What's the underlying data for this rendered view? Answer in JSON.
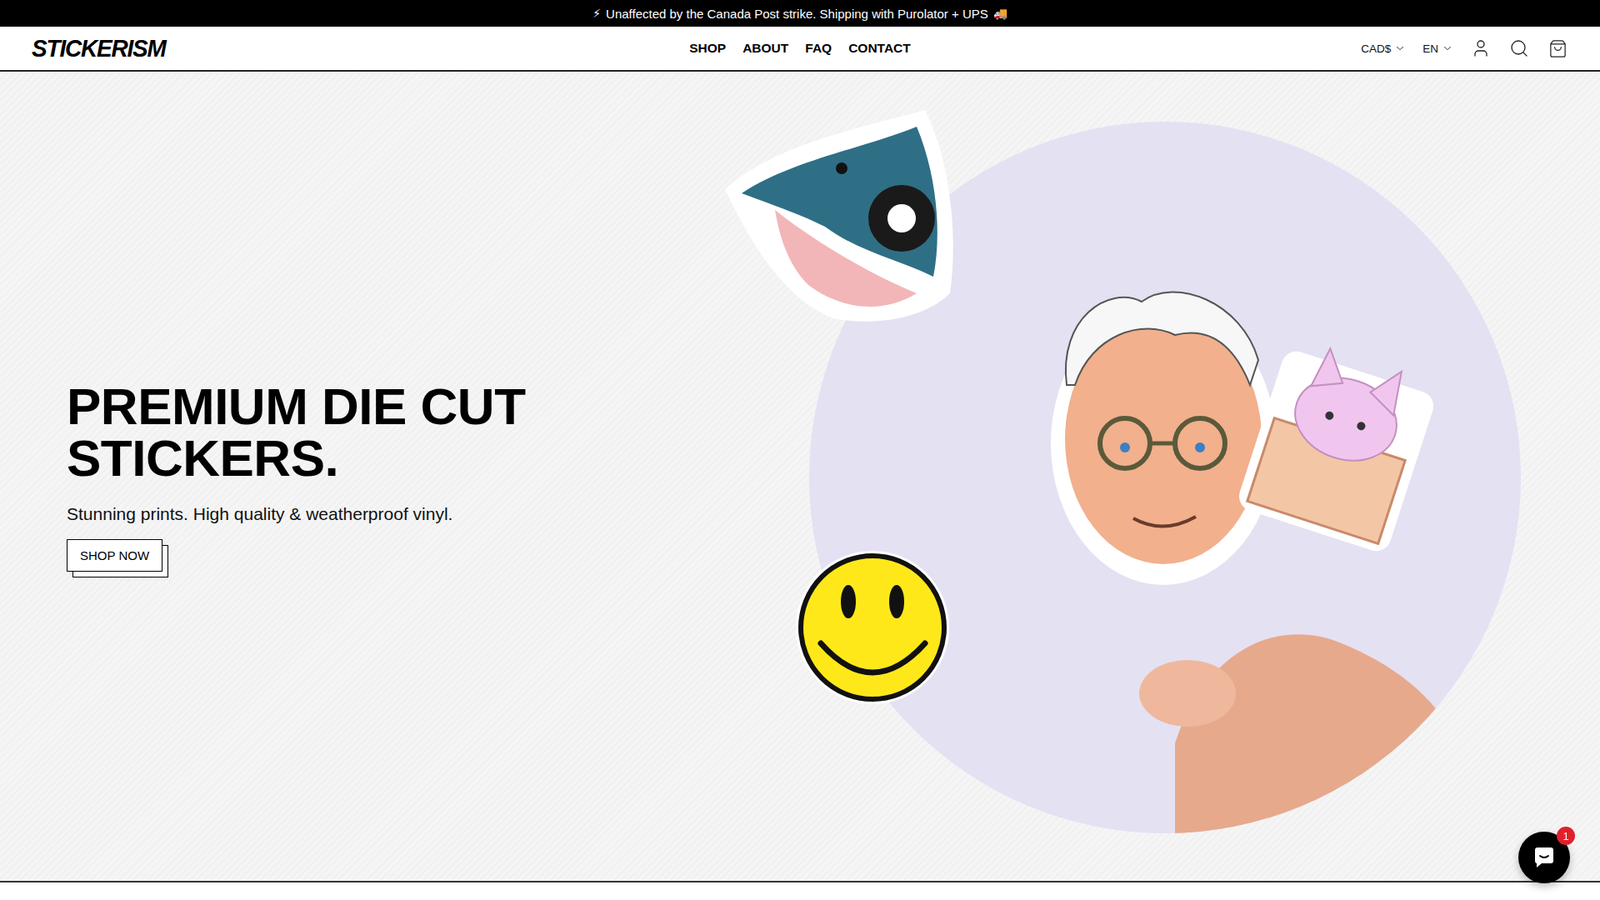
{
  "announcement": {
    "icon_left": "⚡",
    "text": "Unaffected by the Canada Post strike. Shipping with Purolator + UPS",
    "icon_right": "🚚"
  },
  "header": {
    "logo": "STICKERISM",
    "nav": [
      {
        "label": "SHOP"
      },
      {
        "label": "ABOUT"
      },
      {
        "label": "FAQ"
      },
      {
        "label": "CONTACT"
      }
    ],
    "currency": "CAD$",
    "language": "EN"
  },
  "hero": {
    "title": "PREMIUM DIE CUT STICKERS.",
    "subtitle": "Stunning prints. High quality & weatherproof vinyl.",
    "button": "SHOP NOW"
  },
  "chat": {
    "badge": "1"
  }
}
